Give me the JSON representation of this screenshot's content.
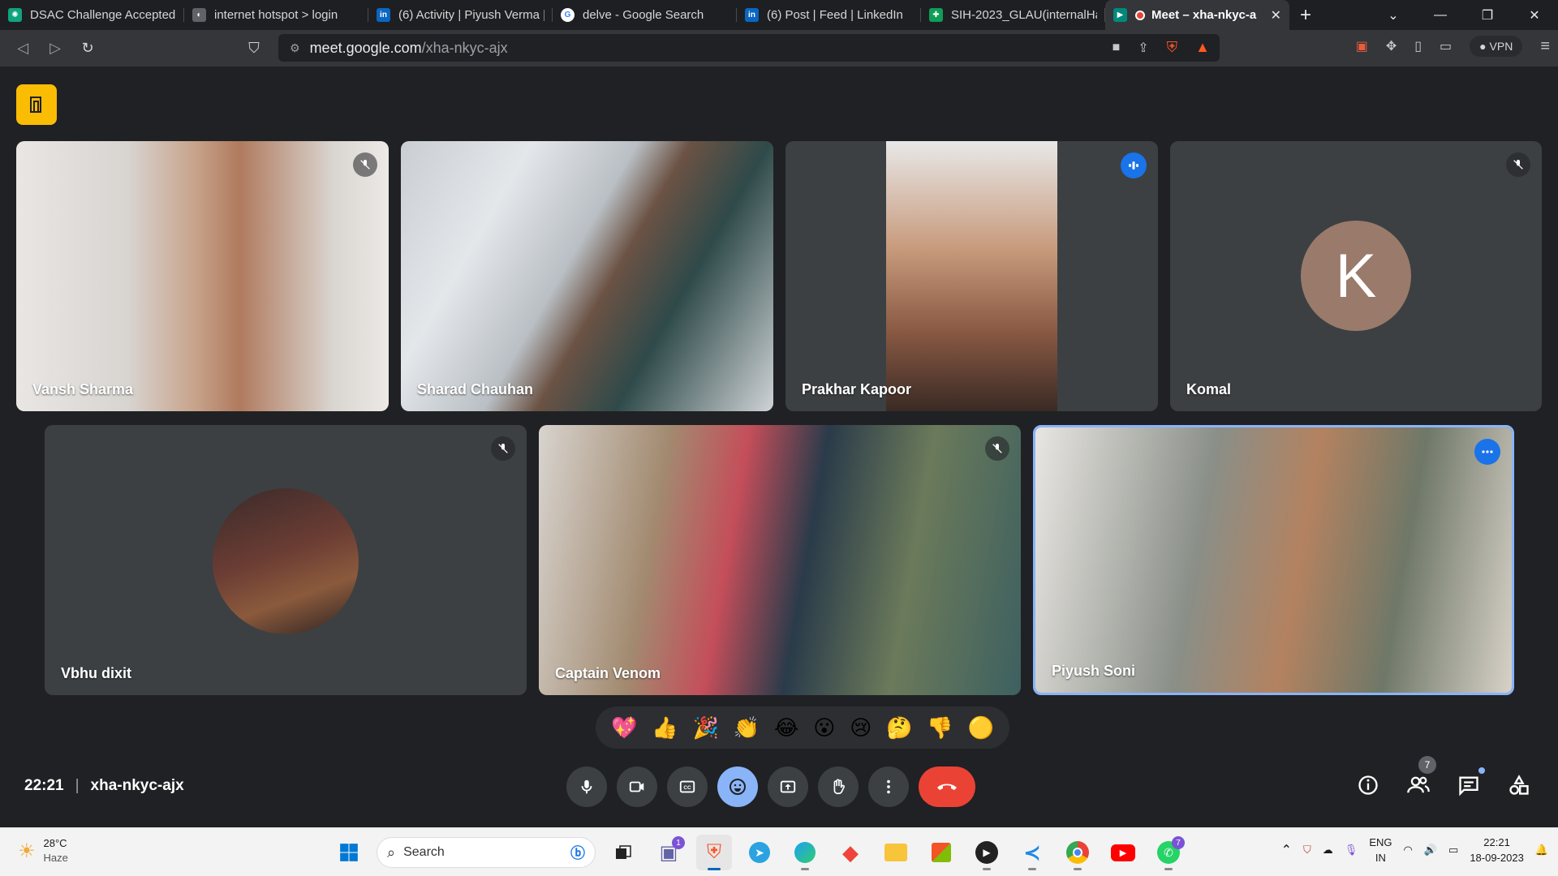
{
  "browser": {
    "tabs": [
      {
        "title": "DSAC Challenge Accepted!",
        "icon": "chatgpt-icon",
        "color": "#10a37f"
      },
      {
        "title": "internet hotspot > login",
        "icon": "globe-icon",
        "color": "#d6d6d6"
      },
      {
        "title": "(6) Activity | Piyush Verma |",
        "icon": "linkedin-icon",
        "color": "#0a66c2"
      },
      {
        "title": "delve - Google Search",
        "icon": "google-icon",
        "color": "#ffffff"
      },
      {
        "title": "(6) Post | Feed | LinkedIn",
        "icon": "linkedin-icon",
        "color": "#0a66c2"
      },
      {
        "title": "SIH-2023_GLAU(internalHa",
        "icon": "sheets-icon",
        "color": "#0f9d58"
      },
      {
        "title": "Meet – xha-nkyc-a",
        "icon": "meet-icon",
        "color": "#00897b",
        "active": true
      }
    ],
    "url_host": "meet.google.com",
    "url_path": "/xha-nkyc-ajx",
    "vpn_label": "VPN"
  },
  "participants": [
    {
      "name": "Vansh Sharma",
      "muted": true
    },
    {
      "name": "Sharad Chauhan",
      "muted": false
    },
    {
      "name": "Prakhar Kapoor",
      "speaking": true
    },
    {
      "name": "Komal",
      "muted": true,
      "initial": "K"
    },
    {
      "name": "Vbhu dixit",
      "muted": true
    },
    {
      "name": "Captain Venom",
      "muted": true
    },
    {
      "name": "Piyush Soni",
      "self": true
    }
  ],
  "reactions": [
    "💖",
    "👍",
    "🎉",
    "👏",
    "😂",
    "😮",
    "😢",
    "🤔",
    "👎",
    "🟡"
  ],
  "meeting": {
    "time": "22:21",
    "code": "xha-nkyc-ajx",
    "people_count": "7"
  },
  "taskbar": {
    "weather_temp": "28°C",
    "weather_desc": "Haze",
    "search_placeholder": "Search",
    "teams_badge": "1",
    "whatsapp_badge": "7",
    "lang_line1": "ENG",
    "lang_line2": "IN",
    "clock_time": "22:21",
    "clock_date": "18-09-2023"
  }
}
